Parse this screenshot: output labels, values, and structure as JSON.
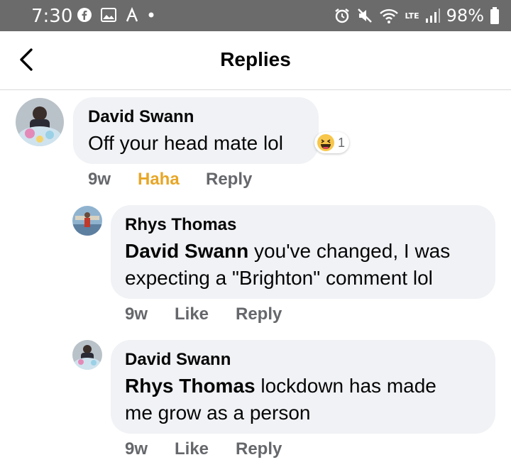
{
  "status_bar": {
    "time": "7:30",
    "battery": "98%",
    "network_label": "LTE"
  },
  "header": {
    "title": "Replies"
  },
  "comments": [
    {
      "author": "David Swann",
      "text": "Off your head mate lol",
      "reaction_icon": "haha-emoji-icon",
      "reaction_count": "1",
      "time": "9w",
      "action_react": "Haha",
      "action_reply": "Reply"
    },
    {
      "author": "Rhys Thomas",
      "mention": "David Swann",
      "text_line1_after_mention": " you've changed, I was",
      "text_line2": "expecting a \"Brighton\" comment lol",
      "time": "9w",
      "action_react": "Like",
      "action_reply": "Reply"
    },
    {
      "author": "David Swann",
      "mention": "Rhys Thomas",
      "text_line1_after_mention": " lockdown has made",
      "text_line2": "me grow as a person",
      "time": "9w",
      "action_react": "Like",
      "action_reply": "Reply"
    }
  ],
  "colors": {
    "haha_active": "#e7a626",
    "bubble_bg": "#f0f2f5",
    "secondary_text": "#65676b"
  }
}
